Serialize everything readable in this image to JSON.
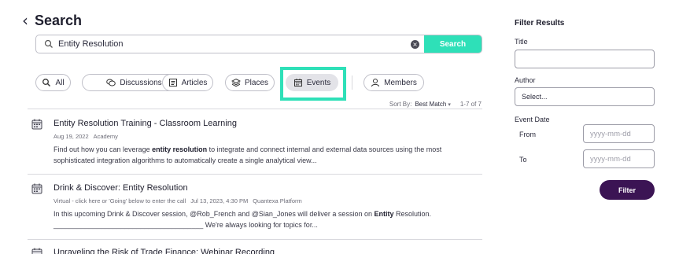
{
  "header": {
    "back_icon": "chevron-left-icon",
    "title": "Search"
  },
  "search": {
    "value": "Entity Resolution",
    "clear_label": "×",
    "button_label": "Search"
  },
  "chips": [
    {
      "label": "All",
      "icon": "search-icon"
    },
    {
      "label": "Discussions",
      "icon": "chat-icon"
    },
    {
      "label": "Articles",
      "icon": "article-icon"
    },
    {
      "label": "Places",
      "icon": "layers-icon"
    },
    {
      "label": "Events",
      "icon": "calendar-icon",
      "active": true
    },
    {
      "label": "Members",
      "icon": "person-icon"
    }
  ],
  "sort": {
    "label": "Sort By:",
    "value": "Best Match",
    "caret": "▾",
    "range": "1-7 of 7"
  },
  "results": [
    {
      "title": "Entity Resolution Training - Classroom Learning",
      "meta": [
        "Aug 19, 2022",
        "Academy"
      ],
      "snippet_before": "Find out how you can leverage ",
      "snippet_bold": "entity resolution",
      "snippet_after": " to integrate and connect internal and external data sources using the most sophisticated integration algorithms to automatically create a single analytical view..."
    },
    {
      "title": "Drink & Discover: Entity Resolution",
      "meta": [
        "Virtual - click here or 'Going' below to enter the call",
        "Jul 13, 2023, 4:30 PM",
        "Quantexa Platform"
      ],
      "snippet_before": "In this upcoming Drink & Discover session, @Rob_French and @Sian_Jones will deliver a session on ",
      "snippet_bold": "Entity",
      "snippet_after": " Resolution. ______________________________________  We're always looking for topics for..."
    },
    {
      "title": "Unraveling the Risk of Trade Finance: Webinar Recording"
    }
  ],
  "filter": {
    "title": "Filter Results",
    "title_label": "Title",
    "title_value": "",
    "author_label": "Author",
    "author_placeholder": "Select...",
    "event_date_label": "Event Date",
    "from_label": "From",
    "from_placeholder": "yyyy-mm-dd",
    "to_label": "To",
    "to_placeholder": "yyyy-mm-dd",
    "button_label": "Filter"
  },
  "colors": {
    "accent": "#2ee0b8",
    "primary_button": "#3b1454",
    "text": "#2b2b3c"
  }
}
